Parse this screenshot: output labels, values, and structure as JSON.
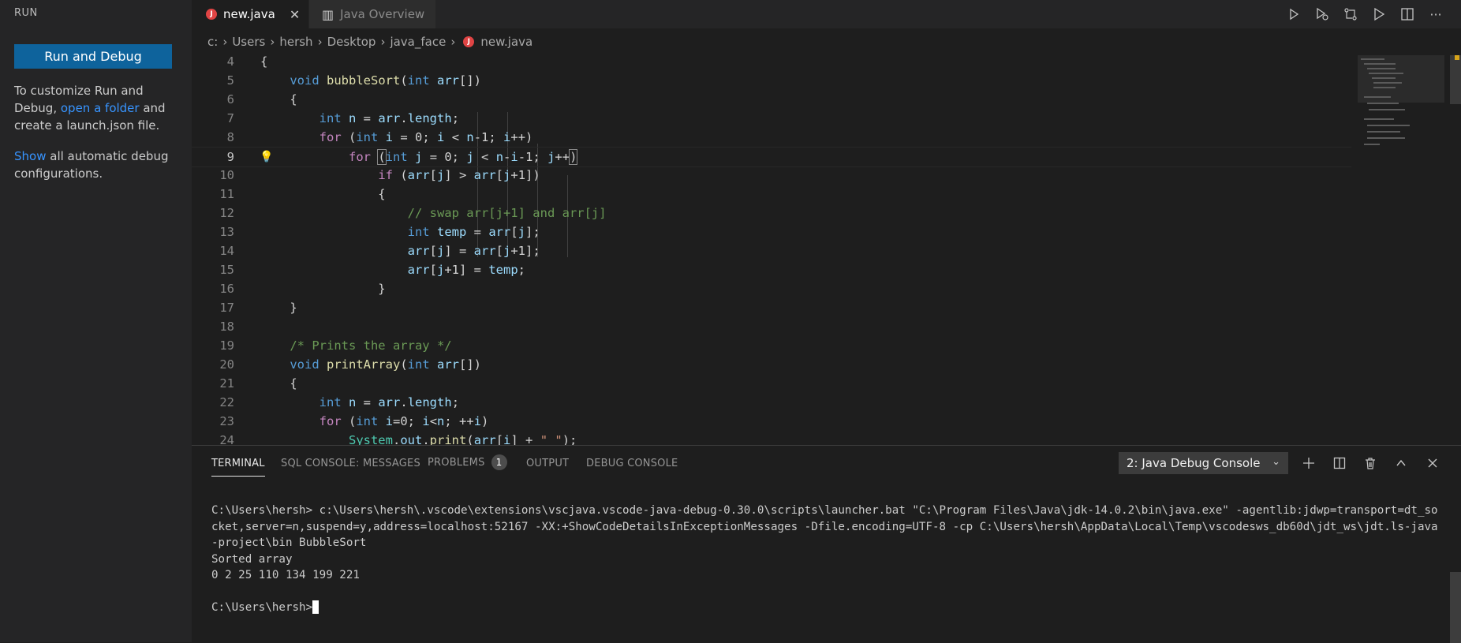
{
  "sidebar": {
    "title": "RUN",
    "run_button": "Run and Debug",
    "help1_pre": "To customize Run and Debug, ",
    "help1_link": "open a folder",
    "help1_post": " and create a launch.json file.",
    "help2_link": "Show",
    "help2_post": " all automatic debug configurations."
  },
  "tabs": [
    {
      "label": "new.java",
      "active": true
    },
    {
      "label": "Java Overview",
      "active": false
    }
  ],
  "breadcrumb": [
    "c:",
    "Users",
    "hersh",
    "Desktop",
    "java_face",
    "new.java"
  ],
  "editor": {
    "line_numbers": [
      "4",
      "5",
      "6",
      "7",
      "8",
      "9",
      "10",
      "11",
      "12",
      "13",
      "14",
      "15",
      "16",
      "17",
      "18",
      "19",
      "20",
      "21",
      "22",
      "23",
      "24"
    ],
    "current_line": "9"
  },
  "panel": {
    "tabs": [
      "TERMINAL",
      "SQL CONSOLE: MESSAGES",
      "PROBLEMS",
      "OUTPUT",
      "DEBUG CONSOLE"
    ],
    "problems_count": "1",
    "console_select": "2: Java Debug Console"
  },
  "terminal": {
    "command_line": "C:\\Users\\hersh> c:\\Users\\hersh\\.vscode\\extensions\\vscjava.vscode-java-debug-0.30.0\\scripts\\launcher.bat \"C:\\Program Files\\Java\\jdk-14.0.2\\bin\\java.exe\" -agentlib:jdwp=transport=dt_socket,server=n,suspend=y,address=localhost:52167 -XX:+ShowCodeDetailsInExceptionMessages -Dfile.encoding=UTF-8 -cp C:\\Users\\hersh\\AppData\\Local\\Temp\\vscodesws_db60d\\jdt_ws\\jdt.ls-java-project\\bin BubbleSort",
    "output1": "Sorted array",
    "output2": "0 2 25 110 134 199 221",
    "prompt": "C:\\Users\\hersh>"
  },
  "colors": {
    "accent_button": "#0e639c",
    "link": "#3794ff",
    "java_icon": "#e04444"
  }
}
